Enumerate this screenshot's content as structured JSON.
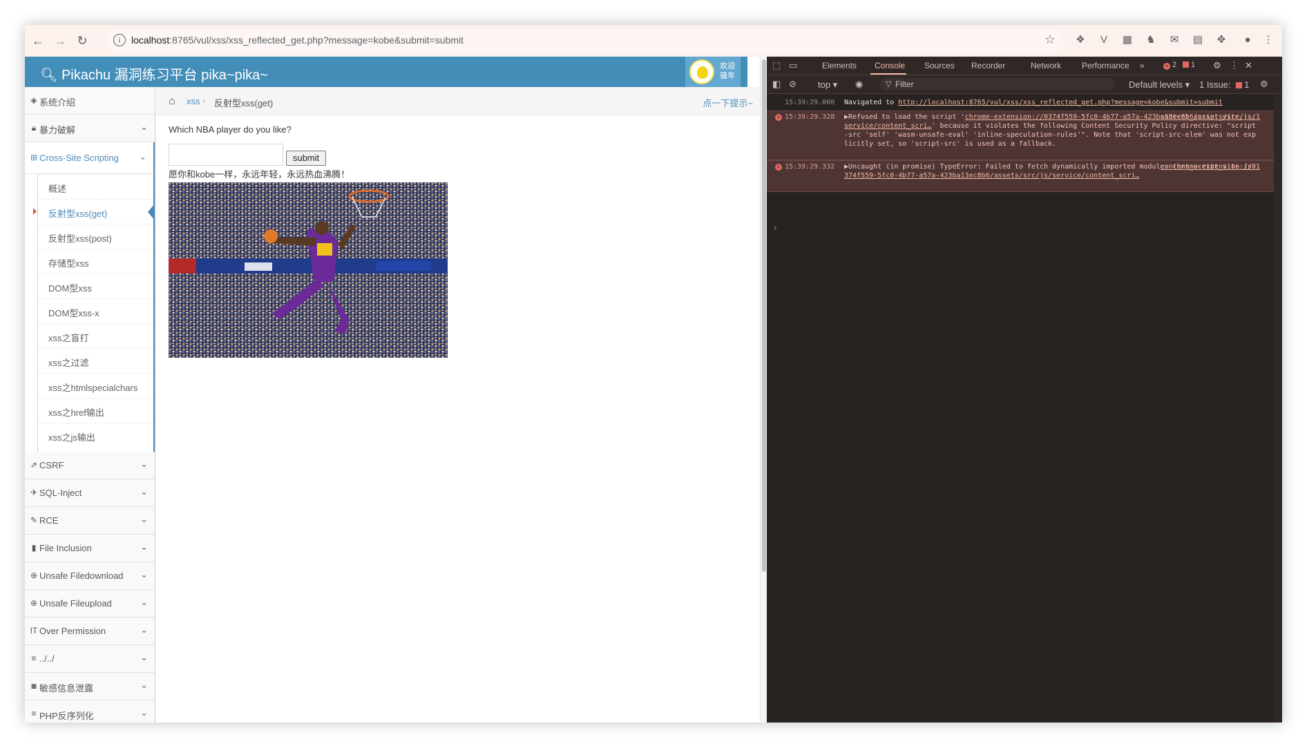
{
  "browser": {
    "url_host": "localhost",
    "url_rest": ":8765/vul/xss/xss_reflected_get.php?message=kobe&submit=submit"
  },
  "site": {
    "title": "Pikachu 漏洞练习平台 pika~pika~",
    "welcome_line1": "欢迎",
    "welcome_line2": "骚年"
  },
  "sidebar": {
    "items": [
      {
        "label": "系统介绍",
        "icon": "tags-icon"
      },
      {
        "label": "暴力破解",
        "icon": "lock-icon"
      },
      {
        "label": "Cross-Site Scripting",
        "icon": "sitemap-icon"
      },
      {
        "label": "CSRF",
        "icon": "share-icon"
      },
      {
        "label": "SQL-Inject",
        "icon": "plane-icon"
      },
      {
        "label": "RCE",
        "icon": "pencil-icon"
      },
      {
        "label": "File Inclusion",
        "icon": "file-icon"
      },
      {
        "label": "Unsafe Filedownload",
        "icon": "download-icon"
      },
      {
        "label": "Unsafe Fileupload",
        "icon": "upload-icon"
      },
      {
        "label": "Over Permission",
        "icon": "text-cursor-icon"
      },
      {
        "label": "../../",
        "icon": "list-icon"
      },
      {
        "label": "敏感信息泄露",
        "icon": "camera-icon"
      },
      {
        "label": "PHP反序列化",
        "icon": "list-icon"
      }
    ],
    "xss_subitems": [
      "概述",
      "反射型xss(get)",
      "反射型xss(post)",
      "存储型xss",
      "DOM型xss",
      "DOM型xss-x",
      "xss之盲打",
      "xss之过滤",
      "xss之htmlspecialchars",
      "xss之href输出",
      "xss之js输出"
    ]
  },
  "breadcrumb": {
    "link": "xss",
    "separator": "›",
    "current": "反射型xss(get)",
    "hint": "点一下提示~"
  },
  "content": {
    "question": "Which NBA player do you like?",
    "input_value": "",
    "submit_label": "submit",
    "result": "愿你和kobe一样，永远年轻，永远热血沸腾！"
  },
  "devtools": {
    "tabs": [
      "Elements",
      "Console",
      "Sources",
      "Recorder",
      "Network",
      "Performance"
    ],
    "more": "»",
    "error_count": "2",
    "issue_count": "1",
    "context": "top ▾",
    "filter_placeholder": "Filter",
    "levels": "Default levels ▾",
    "issues": "1 Issue:",
    "issues_count": "1",
    "logs": [
      {
        "time": "15:39:29.000",
        "text_before": "Navigated to ",
        "link": "http://localhost:8765/vul/xss/xss_reflected_get.php?message=kobe&submit=submit"
      },
      {
        "time": "15:39:29.328",
        "text": "▶Refused to load the script '",
        "link": "chrome-extension://0374f559-5fc0-4b77-a57a-423ba13ec8b6/assets/src/js/service/content_scri…",
        "text2": "' because it violates the following Content Security Policy directive: \"script-src 'self' 'wasm-unsafe-eval' 'inline-speculation-rules'\". Note that 'script-src-elem' was not explicitly set, so 'script-src' is used as a fallback.",
        "source": "content_script_vite.js:1"
      },
      {
        "time": "15:39:29.332",
        "text": "▶Uncaught (in promise) TypeError: Failed to fetch dynamically imported module:",
        "link": "chrome-extension://0374f559-5fc0-4b77-a57a-423ba13ec8b6/assets/src/js/service/content_scri…",
        "source": "content_script_vite.js:1"
      }
    ],
    "prompt": "›"
  }
}
